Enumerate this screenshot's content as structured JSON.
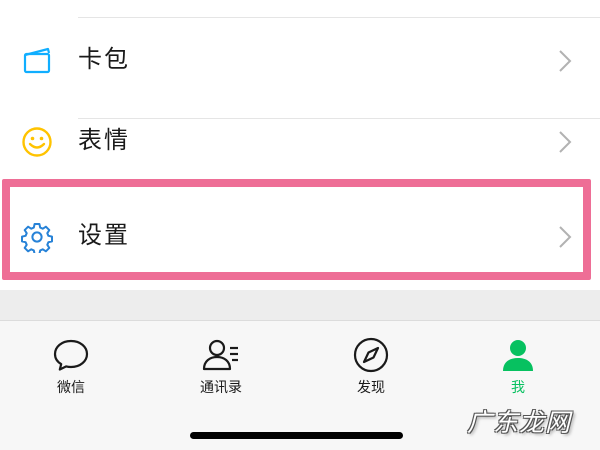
{
  "menu": {
    "items": [
      {
        "label": "卡包",
        "icon": "card-pack-icon",
        "icon_color": "#10aeff"
      },
      {
        "label": "表情",
        "icon": "sticker-smiley-icon",
        "icon_color": "#ffc300"
      },
      {
        "label": "设置",
        "icon": "gear-icon",
        "icon_color": "#2782d7",
        "highlighted": true
      }
    ],
    "highlight_color": "#ee6e96"
  },
  "tabbar": {
    "tabs": [
      {
        "label": "微信",
        "icon": "chat-bubble-icon",
        "active": false
      },
      {
        "label": "通讯录",
        "icon": "contacts-icon",
        "active": false
      },
      {
        "label": "发现",
        "icon": "compass-icon",
        "active": false
      },
      {
        "label": "我",
        "icon": "person-icon",
        "active": true
      }
    ],
    "active_color": "#07c160"
  },
  "watermark": {
    "text": "广东龙网"
  }
}
